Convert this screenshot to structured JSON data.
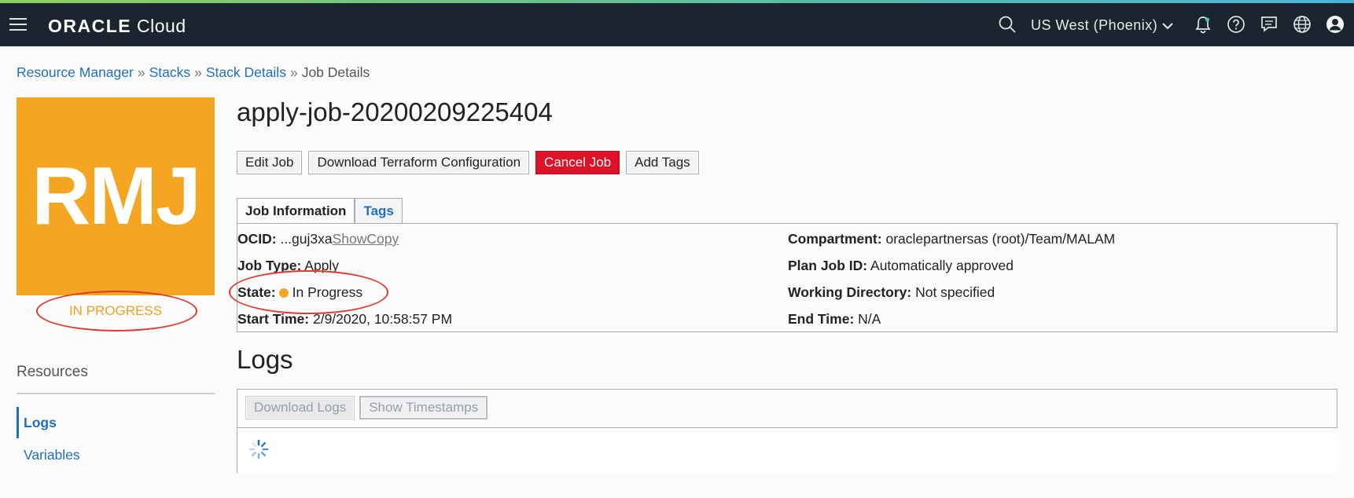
{
  "topbar": {
    "brand_bold": "ORACLE",
    "brand_regular": "Cloud",
    "region": "US West (Phoenix)"
  },
  "breadcrumb": {
    "items": [
      "Resource Manager",
      "Stacks",
      "Stack Details"
    ],
    "current": "Job Details",
    "separator": "»"
  },
  "avatar": {
    "initials": "RMJ",
    "color": "#f4a623"
  },
  "status": {
    "label": "IN PROGRESS",
    "color": "#f0a020"
  },
  "resources": {
    "title": "Resources",
    "items": [
      "Logs",
      "Variables"
    ]
  },
  "job": {
    "title": "apply-job-20200209225404",
    "buttons": {
      "edit": "Edit Job",
      "download": "Download Terraform Configuration",
      "cancel": "Cancel Job",
      "tags": "Add Tags"
    },
    "tabs": [
      "Job Information",
      "Tags"
    ],
    "info": {
      "ocid_label": "OCID:",
      "ocid_value": "...guj3xa",
      "ocid_show": "Show",
      "ocid_copy": "Copy",
      "job_type_label": "Job Type:",
      "job_type_value": "Apply",
      "state_label": "State:",
      "state_value": "In Progress",
      "start_label": "Start Time:",
      "start_value": "2/9/2020, 10:58:57 PM",
      "compartment_label": "Compartment:",
      "compartment_value": "oraclepartnersas (root)/Team/MALAM",
      "plan_label": "Plan Job ID:",
      "plan_value": "Automatically approved",
      "workdir_label": "Working Directory:",
      "workdir_value": "Not specified",
      "end_label": "End Time:",
      "end_value": "N/A"
    }
  },
  "logs": {
    "title": "Logs",
    "download_label": "Download Logs",
    "timestamps_label": "Show Timestamps"
  },
  "colors": {
    "link": "#1f6fbf",
    "danger": "#dd1128",
    "annotation": "#e03a2c",
    "topbar": "#1b2530"
  }
}
